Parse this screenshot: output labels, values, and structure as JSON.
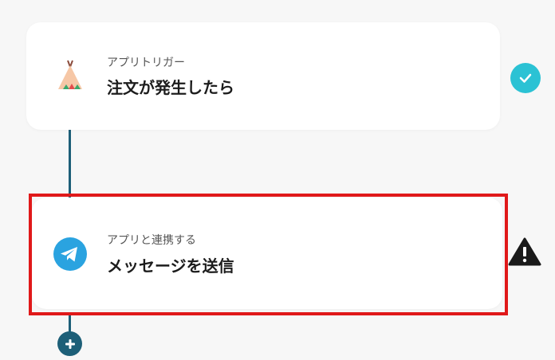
{
  "flow": {
    "steps": [
      {
        "subtitle": "アプリトリガー",
        "title": "注文が発生したら",
        "icon": "tepee-icon",
        "status": "success"
      },
      {
        "subtitle": "アプリと連携する",
        "title": "メッセージを送信",
        "icon": "telegram-icon",
        "status": "warning"
      }
    ]
  },
  "colors": {
    "connector": "#1d5f78",
    "success": "#2bc2d4",
    "highlight": "#e0191a",
    "telegram": "#2aa3e0"
  }
}
